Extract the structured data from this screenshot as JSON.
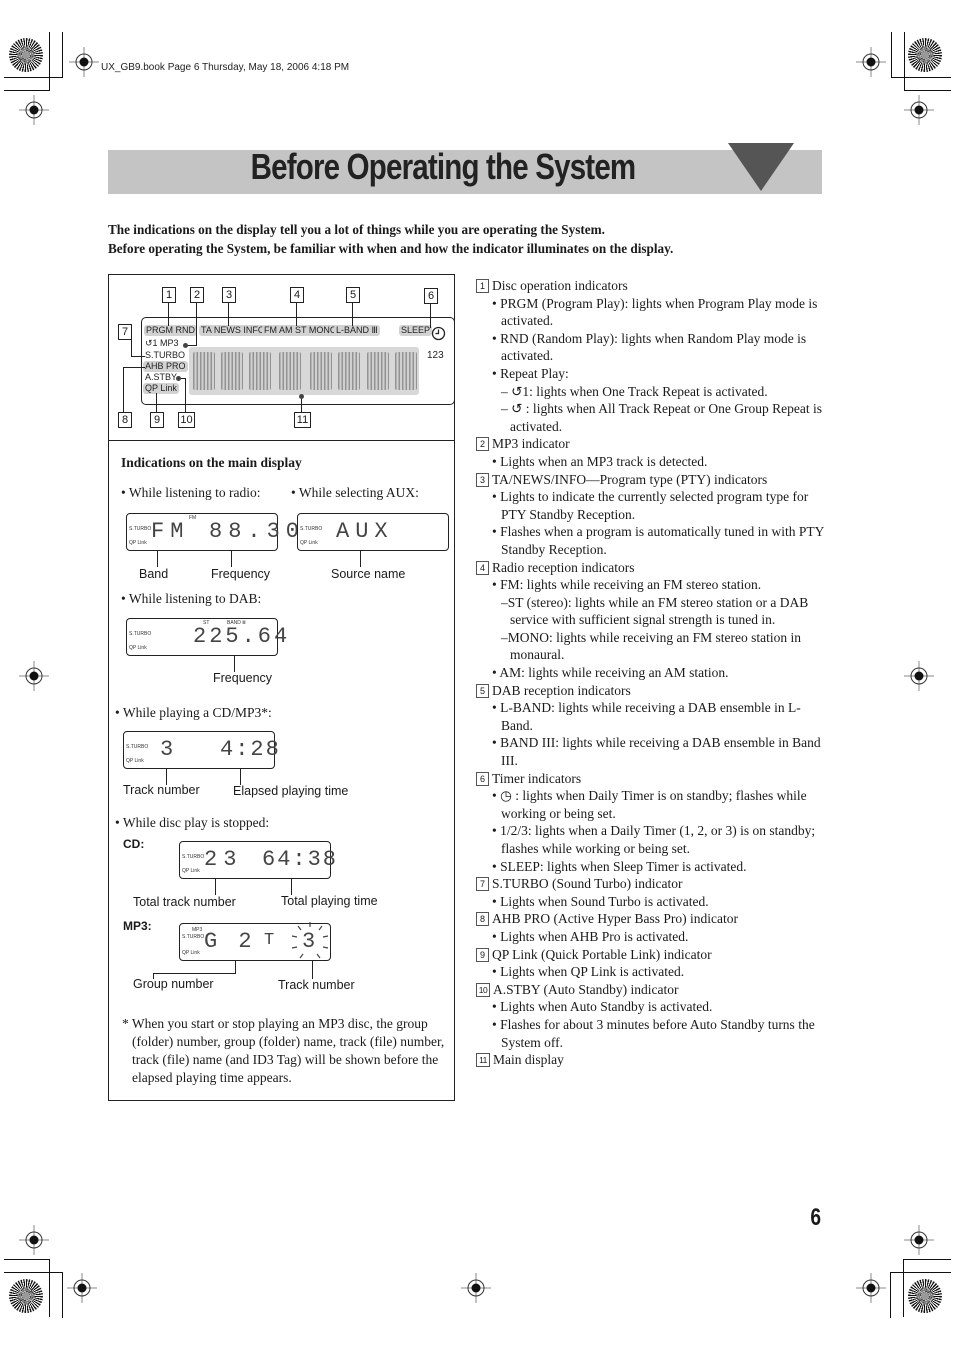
{
  "print_header": "UX_GB9.book  Page 6  Thursday, May 18, 2006  4:18 PM",
  "title": "Before Operating the System",
  "intro": [
    "The indications on the display tell you a lot of things while you are operating the System.",
    "Before operating the System, be familiar with when and how the indicator illuminates on the display."
  ],
  "diagram": {
    "callouts": [
      "1",
      "2",
      "3",
      "4",
      "5",
      "6",
      "7",
      "8",
      "9",
      "10",
      "11"
    ],
    "indicators": {
      "prgm_rnd": "PRGM RND",
      "ta_news_info": "TA NEWS INFO",
      "fm_am_st_mono": "FM AM ST MONO",
      "l_band": "L-BAND Ⅲ",
      "sleep": "SLEEP",
      "repeat_mp3": "↺1 MP3",
      "s_turbo": "S.TURBO",
      "ahb_pro": "AHB PRO",
      "a_stby": "A.STBY",
      "qp_link": "QP Link",
      "timer_nums": "123"
    },
    "icons": {
      "timer": "clock-icon",
      "repeat": "repeat-icon"
    }
  },
  "main_display": {
    "heading": "Indications on the main display",
    "radio": {
      "label": "• While listening to radio:",
      "top": "FM",
      "band_text": "FM",
      "value": "88.30",
      "captions": [
        "Band",
        "Frequency"
      ]
    },
    "aux": {
      "label": "• While selecting AUX:",
      "value": "AUX",
      "captions": [
        "Source name"
      ]
    },
    "dab": {
      "label": "• While listening to DAB:",
      "top_left": "ST",
      "top_right": "BAND Ⅲ",
      "value": "225.64",
      "captions": [
        "Frequency"
      ]
    },
    "cd_mp3": {
      "label": "• While playing a CD/MP3*:",
      "track": "3",
      "time": "4:28",
      "captions": [
        "Track number",
        "Elapsed playing time"
      ]
    },
    "stopped": {
      "label": "• While disc play is stopped:",
      "cd": {
        "tag": "CD:",
        "tracks": "23",
        "time": "64:38",
        "captions": [
          "Total track number",
          "Total playing time"
        ]
      },
      "mp3": {
        "tag": "MP3:",
        "mini_top": "MP3",
        "group": "G 2",
        "track_t": "T",
        "track": "3",
        "captions": [
          "Group number",
          "Track number"
        ]
      }
    },
    "lcd_side": {
      "s_turbo": "S.TURBO",
      "qp_link": "QP Link"
    },
    "footnote": "* When you start or stop playing an MP3 disc, the group (folder) number, group (folder) name, track (file) number, track (file) name (and ID3 Tag) will be shown before the elapsed playing time appears."
  },
  "descriptions": [
    {
      "num": "1",
      "title": "Disc operation indicators",
      "bullets": [
        {
          "text": "• PRGM (Program Play): lights when Program Play mode is activated."
        },
        {
          "text": "• RND (Random Play): lights when Random Play mode is activated."
        },
        {
          "text": "• Repeat Play:"
        },
        {
          "text": "– ↺1: lights when One Track Repeat is activated.",
          "dash": true
        },
        {
          "text": "– ↺ : lights when All Track Repeat or One Group Repeat is activated.",
          "dash": true
        }
      ]
    },
    {
      "num": "2",
      "title": "MP3 indicator",
      "bullets": [
        {
          "text": "• Lights when an MP3 track is detected."
        }
      ]
    },
    {
      "num": "3",
      "title": "TA/NEWS/INFO—Program type (PTY) indicators",
      "bullets": [
        {
          "text": "• Lights to indicate the currently selected program type for PTY Standby Reception."
        },
        {
          "text": "• Flashes when a program is automatically tuned in with PTY Standby Reception."
        }
      ]
    },
    {
      "num": "4",
      "title": "Radio reception indicators",
      "bullets": [
        {
          "text": "• FM: lights while receiving an FM stereo station."
        },
        {
          "text": "–ST (stereo): lights while an FM stereo station or a DAB service with sufficient signal strength is tuned in.",
          "dash": true
        },
        {
          "text": "–MONO: lights while receiving an FM stereo station in monaural.",
          "dash": true
        },
        {
          "text": "• AM: lights while receiving an AM station."
        }
      ]
    },
    {
      "num": "5",
      "title": "DAB reception indicators",
      "bullets": [
        {
          "text": "• L-BAND: lights while receiving a DAB ensemble in L-Band."
        },
        {
          "text": "• BAND III: lights while receiving a DAB ensemble in Band III."
        }
      ]
    },
    {
      "num": "6",
      "title": "Timer indicators",
      "bullets": [
        {
          "text": "• ◷ : lights when Daily Timer is on standby; flashes while working or being set."
        },
        {
          "text": "• 1/2/3: lights when a Daily Timer (1, 2, or 3) is on standby; flashes while working or being set."
        },
        {
          "text": "• SLEEP: lights when Sleep Timer is activated."
        }
      ]
    },
    {
      "num": "7",
      "title": "S.TURBO (Sound Turbo) indicator",
      "bullets": [
        {
          "text": "• Lights when Sound Turbo is activated."
        }
      ]
    },
    {
      "num": "8",
      "title": "AHB PRO (Active Hyper Bass Pro) indicator",
      "bullets": [
        {
          "text": "• Lights when AHB Pro is activated."
        }
      ]
    },
    {
      "num": "9",
      "title": "QP Link (Quick Portable Link) indicator",
      "bullets": [
        {
          "text": "• Lights when QP Link is activated."
        }
      ]
    },
    {
      "num": "10",
      "title": "A.STBY (Auto Standby) indicator",
      "bullets": [
        {
          "text": "• Lights when Auto Standby is activated."
        },
        {
          "text": "• Flashes for about 3 minutes before Auto Standby turns the System off."
        }
      ]
    },
    {
      "num": "11",
      "title": "Main display",
      "bullets": []
    }
  ],
  "page_number": "6"
}
